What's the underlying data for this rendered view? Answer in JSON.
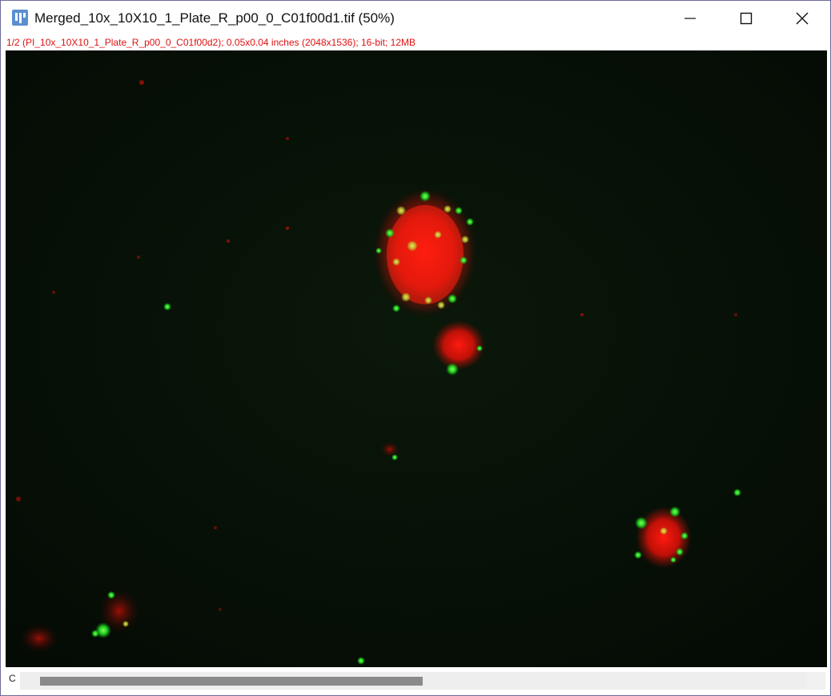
{
  "window": {
    "title": "Merged_10x_10X10_1_Plate_R_p00_0_C01f00d1.tif (50%)",
    "app_icon": "imagej-icon",
    "controls": {
      "minimize": "minimize-icon",
      "maximize": "maximize-icon",
      "close": "close-icon"
    }
  },
  "image_info": "1/2 (PI_10x_10X10_1_Plate_R_p00_0_C01f00d2); 0.05x0.04 inches (2048x1536); 16-bit; 12MB",
  "channel_slider": {
    "label": "C",
    "position_fraction": 0.48
  },
  "image": {
    "description_colors": {
      "background": "#061006",
      "red_channel": "#ff2010",
      "green_channel": "#30ff30"
    }
  },
  "colors": {
    "info_text": "#dd1111",
    "scroll_thumb": "#8a8a8a"
  }
}
